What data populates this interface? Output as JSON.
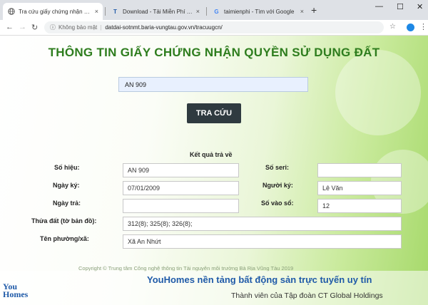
{
  "browser": {
    "tabs": [
      {
        "label": "Tra cứu giấy chứng nhận QSDĐ",
        "icon": "globe-icon",
        "active": true
      },
      {
        "label": "Download - Tải Miễn Phí VN - Ph",
        "icon": "t-icon",
        "active": false
      },
      {
        "label": "taimienphi - Tìm với Google",
        "icon": "google-icon",
        "active": false
      }
    ],
    "close_glyph": "×",
    "new_tab_glyph": "+",
    "window_controls": {
      "minimize": "—",
      "maximize": "☐",
      "close": "✕"
    },
    "security_label": "Không bảo mật",
    "url": "datdai-sotnmt.baria-vungtau.gov.vn/tracuugcn/"
  },
  "page": {
    "title": "THÔNG TIN GIẤY CHỨNG NHẬN QUYỀN SỬ DỤNG ĐẤT",
    "search_value": "AN 909",
    "search_button": "TRA CỨU",
    "result_heading": "Kết quả trả về",
    "fields": {
      "so_hieu": {
        "label": "Số hiệu:",
        "value": "AN 909"
      },
      "so_seri": {
        "label": "Số seri:",
        "value": ""
      },
      "ngay_ky": {
        "label": "Ngày ký:",
        "value": "07/01/2009"
      },
      "nguoi_ky": {
        "label": "Người ký:",
        "value": "Lê Văn"
      },
      "ngay_tra": {
        "label": "Ngày trả:",
        "value": ""
      },
      "so_vao_so": {
        "label": "Số vào sổ:",
        "value": "12"
      },
      "thua_dat": {
        "label": "Thửa đất (tờ bản đồ):",
        "value": "312(8); 325(8); 326(8);"
      },
      "ten_phuong": {
        "label": "Tên phường/xã:",
        "value": "Xã An Nhứt"
      }
    },
    "copyright": "Copyright © Trung tâm Công nghệ thông tin Tài nguyên môi trường Bà Rịa Vũng Tàu 2019"
  },
  "watermark": {
    "logo_line1": "You",
    "logo_line2": "Homes",
    "tagline": "YouHomes nền tảng bất động sản trực tuyến uy tín",
    "member": "Thành viên của Tập đoàn CT Global Holdings"
  },
  "colors": {
    "title_green": "#2e7d1e",
    "button_dark": "#2f3a40",
    "brand_blue": "#1f5aa8"
  }
}
